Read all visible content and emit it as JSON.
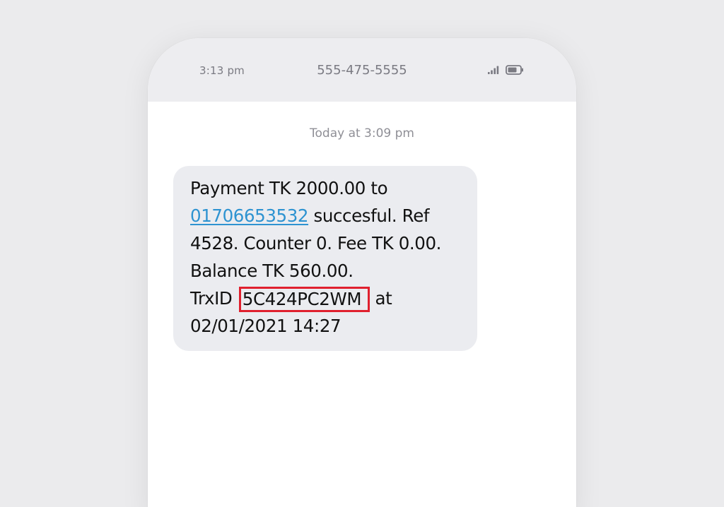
{
  "status_bar": {
    "time": "3:13 pm",
    "contact": "555-475-5555",
    "signal_icon": "signal-bars-icon",
    "battery_icon": "battery-icon"
  },
  "conversation": {
    "timestamp": "Today at 3:09 pm"
  },
  "message": {
    "line1": "Payment TK 2000.00 to",
    "phone_link": "01706653532",
    "line2_rest": " succesful. Ref",
    "line3": "4528. Counter 0. Fee TK 0.00.",
    "line4": "Balance TK 560.00.",
    "line5_prefix": "TrxID ",
    "trx_id": "5C424PC2WM",
    "line5_suffix": " at",
    "line6": "02/01/2021 14:27"
  },
  "colors": {
    "link": "#2e93d1",
    "highlight_box": "#e0202e",
    "bubble": "#ebecf0",
    "status_bar": "#ededf0"
  }
}
